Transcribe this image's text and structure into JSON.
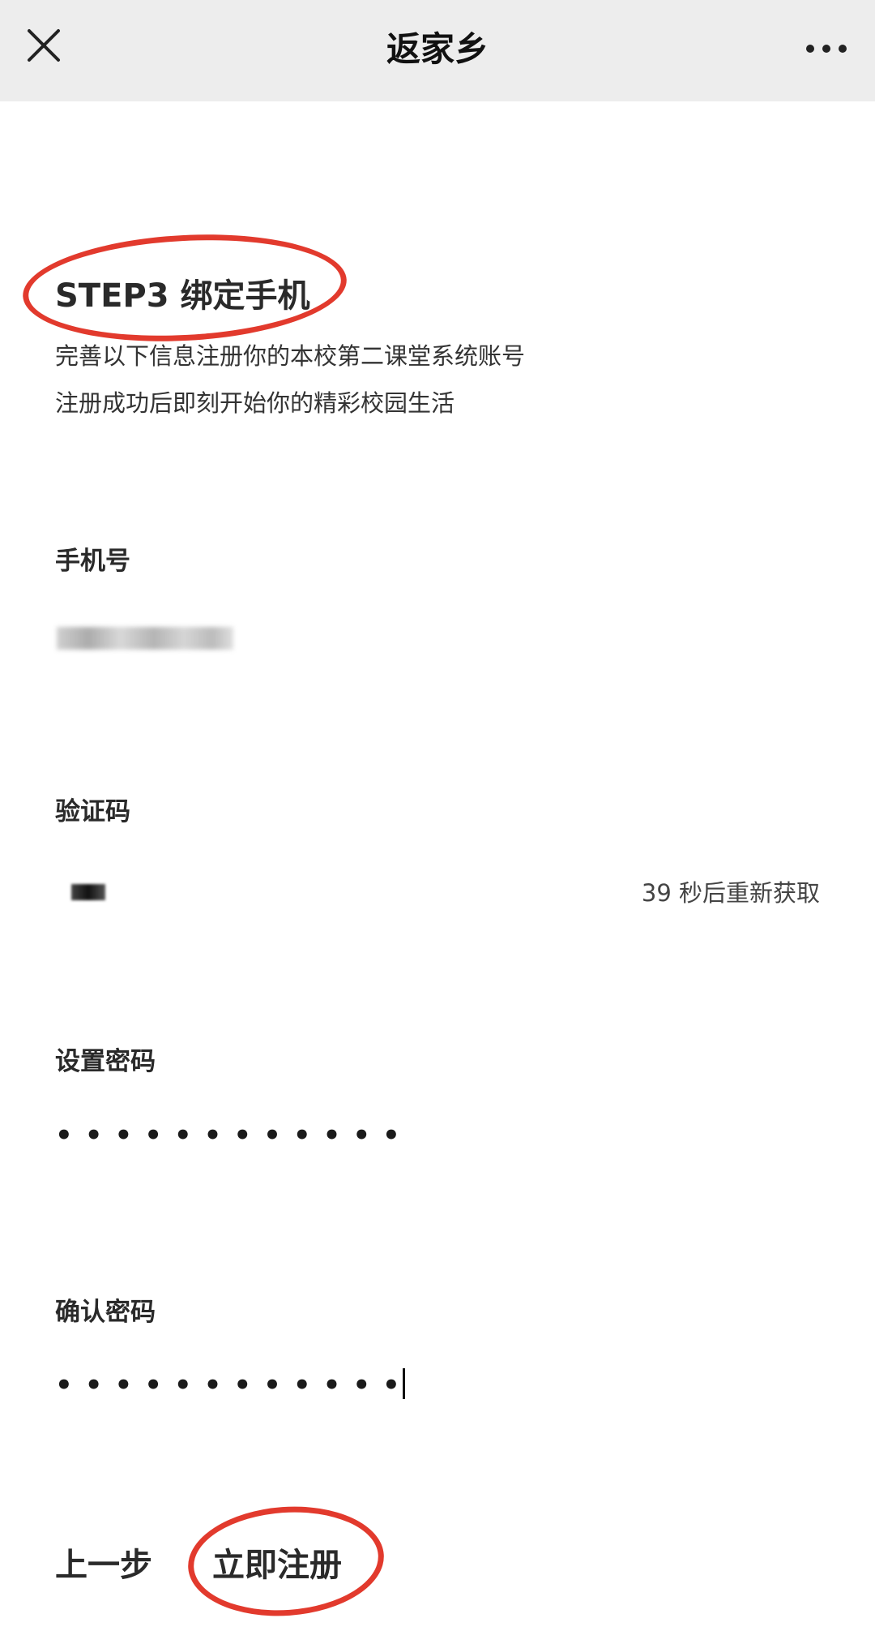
{
  "header": {
    "title": "返家乡",
    "close_icon": "close-icon",
    "more_icon": "more-dots-icon"
  },
  "step": {
    "title": "STEP3 绑定手机",
    "intro_line1": "完善以下信息注册你的本校第二课堂系统账号",
    "intro_line2": "注册成功后即刻开始你的精彩校园生活",
    "highlight_color": "#e23a2d"
  },
  "form": {
    "phone": {
      "label": "手机号"
    },
    "code": {
      "label": "验证码",
      "resend_text": "39 秒后重新获取"
    },
    "password": {
      "label": "设置密码",
      "masked_value": "••••••••••••"
    },
    "confirm": {
      "label": "确认密码",
      "masked_value": "••••••••••••"
    }
  },
  "actions": {
    "prev_label": "上一步",
    "register_label": "立即注册"
  }
}
